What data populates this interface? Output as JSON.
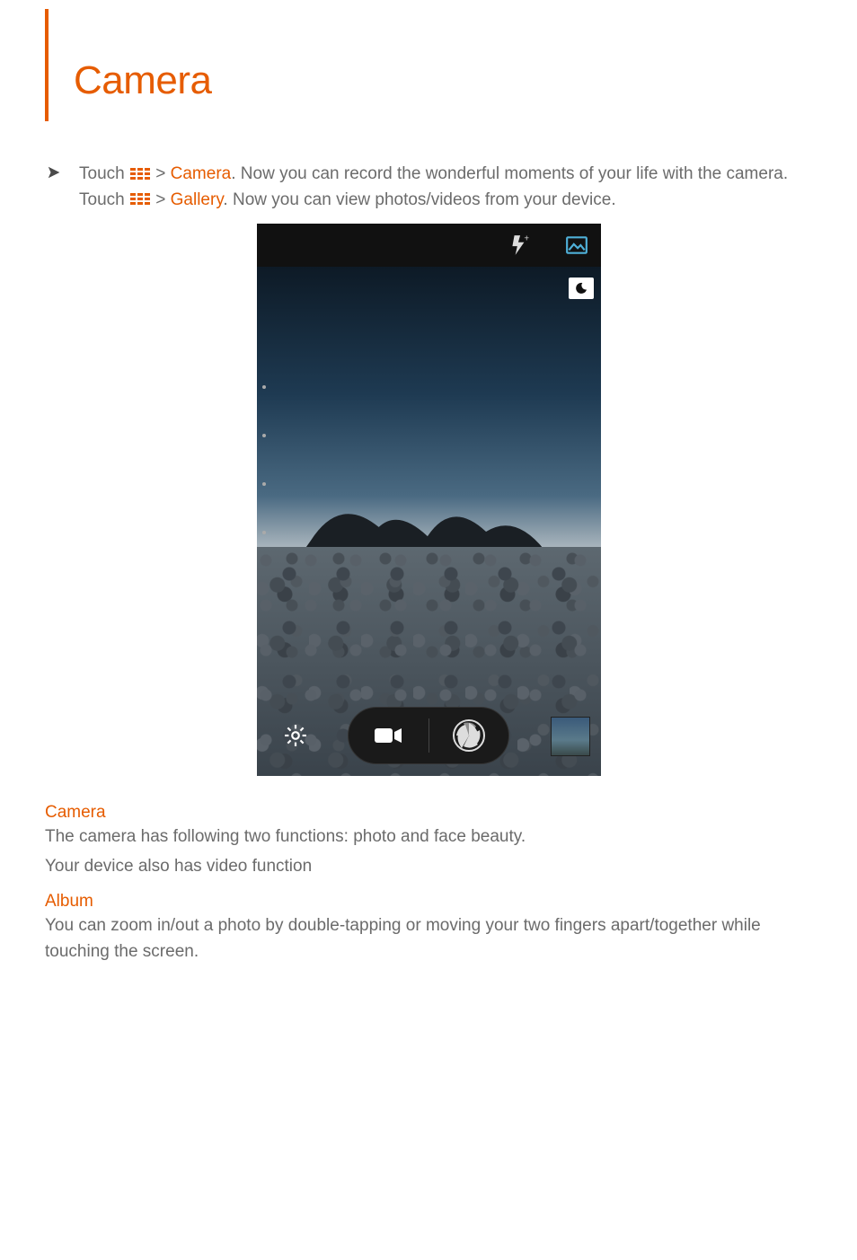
{
  "title": "Camera",
  "step1": {
    "prefix": "Touch ",
    "sep": " > ",
    "link": "Camera",
    "suffix": ". Now you can record the wonderful moments of your life with the camera."
  },
  "step2": {
    "prefix": "Touch ",
    "sep": "  > ",
    "link": "Gallery",
    "suffix": ". Now you can view photos/videos from your device."
  },
  "sections": {
    "camera": {
      "heading": "Camera",
      "line1": "The camera has following two functions: photo and face beauty.",
      "line2": "Your device also has video function"
    },
    "album": {
      "heading": "Album",
      "body": "You can zoom in/out a photo by double-tapping or moving your two fingers apart/together while touching the screen."
    }
  },
  "colors": {
    "accent": "#e65c00",
    "body_text": "#6b6b6b"
  },
  "camera_ui": {
    "topbar_icons": [
      "flash-auto-icon",
      "gallery-icon"
    ],
    "overlay_icon": "night-mode-icon",
    "bottom": {
      "settings": "settings-icon",
      "video": "video-icon",
      "shutter": "shutter-icon",
      "thumbnail": "last-photo-thumbnail"
    }
  }
}
